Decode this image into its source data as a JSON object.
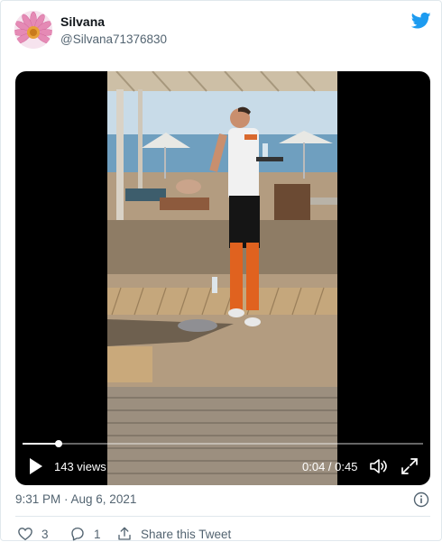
{
  "author": {
    "display_name": "Silvana",
    "handle": "@Silvana71376830"
  },
  "video": {
    "views": "143 views",
    "time": "0:04 / 0:45",
    "progress": 0.09
  },
  "timestamp": "9:31 PM · Aug 6, 2021",
  "actions": {
    "likes": "3",
    "replies": "1",
    "share_label": "Share this Tweet"
  },
  "colors": {
    "brand": "#1d9bf0",
    "secondary_text": "#536471"
  },
  "icons": [
    "flower-avatar",
    "twitter-bird-icon",
    "play-icon",
    "volume-icon",
    "fullscreen-icon",
    "info-icon",
    "heart-icon",
    "reply-icon",
    "share-icon"
  ]
}
